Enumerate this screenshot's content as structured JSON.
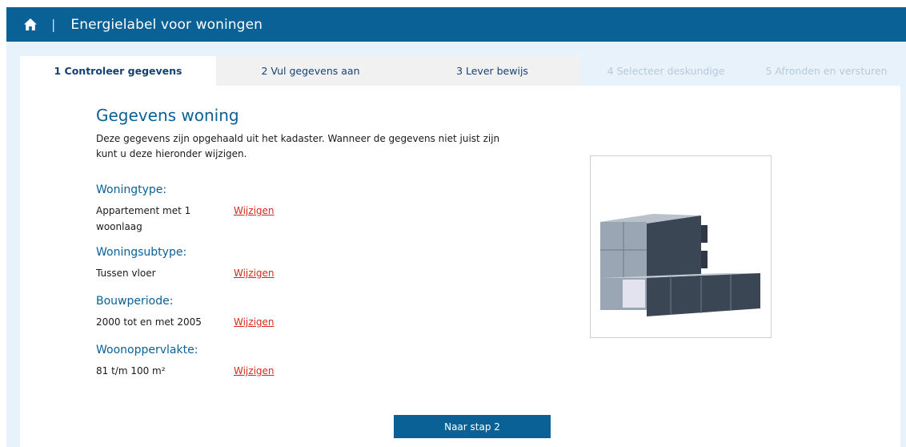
{
  "header": {
    "separator": "|",
    "title": "Energielabel voor woningen"
  },
  "tabs": [
    {
      "label": "1 Controleer gegevens",
      "state": "active"
    },
    {
      "label": "2 Vul gegevens aan",
      "state": "normal"
    },
    {
      "label": "3 Lever bewijs",
      "state": "normal"
    },
    {
      "label": "4 Selecteer deskundige",
      "state": "disabled"
    },
    {
      "label": "5 Afronden en versturen",
      "state": "disabled"
    }
  ],
  "main": {
    "title": "Gegevens woning",
    "intro": "Deze gegevens zijn opgehaald uit het kadaster. Wanneer de gegevens niet juist zijn kunt u deze hieronder wijzigen.",
    "fields": [
      {
        "label": "Woningtype:",
        "value": "Appartement met 1 woonlaag",
        "action": "Wijzigen"
      },
      {
        "label": "Woningsubtype:",
        "value": "Tussen vloer",
        "action": "Wijzigen"
      },
      {
        "label": "Bouwperiode:",
        "value": "2000 tot en met 2005",
        "action": "Wijzigen"
      },
      {
        "label": "Woonoppervlakte:",
        "value": "81 t/m 100 m²",
        "action": "Wijzigen"
      }
    ],
    "next_button": "Naar stap 2"
  },
  "icons": {
    "home": "home-icon",
    "illustration": "building-illustration"
  },
  "colors": {
    "header_bg": "#0a6196",
    "page_bg": "#e8f2fb",
    "link": "#d52b1e",
    "accent_text": "#0a6196"
  }
}
